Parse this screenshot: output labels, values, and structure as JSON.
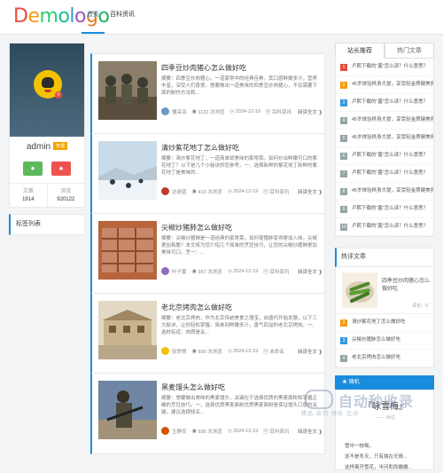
{
  "header": {
    "logo": [
      "D",
      "e",
      "m",
      "o",
      "l",
      "o",
      "g",
      "o"
    ],
    "logo_colors": [
      "#e84c3d",
      "#f39c12",
      "#2ecc71",
      "#1abc9c",
      "#3498db",
      "#9b59b6",
      "#e67e22",
      "#27ae60"
    ],
    "nav": [
      "首页",
      "百科资讯"
    ]
  },
  "profile": {
    "name": "admin",
    "badge": "管理",
    "wechat_icon": "wechat-icon",
    "qq_icon": "qq-icon",
    "stats": [
      {
        "label": "文章",
        "value": "1914"
      },
      {
        "label": "浏览",
        "value": "920122"
      }
    ]
  },
  "tags": {
    "title": "标签列表"
  },
  "posts": [
    {
      "title": "四季豆炒肉猪心怎么做好吃",
      "desc": "摘要：四季豆炒肉猪心，一道家常中的经典佳肴，其口感鲜嫩多汁，营养丰富，深受人们喜爱。想要做出一道美味的四季豆炒肉猪心，不仅需要下面的制作方法和...",
      "author": "懂采羽",
      "views": "1132 次浏览",
      "date": "2024-12-19",
      "cat": "百科资讯",
      "more": "阅读全文"
    },
    {
      "title": "清炒紫花地丁怎么做好吃",
      "desc": "摘要：清炒紫花地丁，一道简单却美味的家常菜。如何炒出鲜嫩可口的紫花地丁？以下是几个小秘诀供您参考。一、选择新鲜的紫花地丁新鲜的紫花地丁是美味的...",
      "author": "访谢蓝",
      "views": "413 次浏览",
      "date": "2024-12-19",
      "cat": "百科资讯",
      "more": "阅读全文"
    },
    {
      "title": "尖椒炒猪肺怎么做好吃",
      "desc": "摘要：尖椒炒猪肺是一道经典的家常菜，如何使猪肺变得更加入味，尖椒更加爽脆？本文将为您介绍几个简单的烹饪技巧，让您的尖椒炒猪肺更加美味可口。烹一：...",
      "author": "叶子夏",
      "views": "357 次浏览",
      "date": "2024-12-19",
      "cat": "百科资讯",
      "more": "阅读全文"
    },
    {
      "title": "老北京烤肉怎么做好吃",
      "desc": "摘要：老北京烤肉，作为北京传统美食之瑰宝，自唐代开始发展，以下三大秘诀，让你轻松掌握。简单到鲜嫩多汁，香气四溢的老北京烤肉。一、选材有道：肉质是关...",
      "author": "张梦想",
      "views": "590 次浏览",
      "date": "2024-12-19",
      "cat": "未命名",
      "more": "阅读全文"
    },
    {
      "title": "黑麦馒头怎么做好吃",
      "desc": "摘要：想要做出美味的黑麦馒头，关键在于选择优质的黑麦面粉和掌握正确的烹饪技巧。一、选择优质黑麦面粉优质黑麦面粉是保证馒头口感的关键，建议选择知名...",
      "author": "玉静安",
      "views": "595 次浏览",
      "date": "2024-12-19",
      "cat": "百科资讯",
      "more": "阅读全文"
    }
  ],
  "sidebar": {
    "tabs": [
      "站长推荐",
      "热门文章"
    ],
    "list": [
      {
        "n": "1",
        "t": "卢熙下载的“菌”怎么读？什么意思？"
      },
      {
        "n": "2",
        "t": "45岁体验终身大提，享受轻金质健美俱乐..."
      },
      {
        "n": "3",
        "t": "卢熙下载的“菌”怎么读？什么意思？"
      },
      {
        "n": "4",
        "t": "45岁体验终身大提，享受轻金质健美俱乐..."
      },
      {
        "n": "5",
        "t": "45岁体验终身大提，享受轻金质健美俱乐..."
      },
      {
        "n": "6",
        "t": "卢熙下载的“菌”怎么读？什么意思？"
      },
      {
        "n": "7",
        "t": "卢熙下载的“菌”怎么读？什么意思？"
      },
      {
        "n": "8",
        "t": "45岁体验终身大提，享受轻金质健美俱乐..."
      },
      {
        "n": "9",
        "t": "卢熙下载的“菌”怎么读？什么意思？"
      },
      {
        "n": "10",
        "t": "卢熙下载的“菌”怎么读？什么意思？"
      }
    ],
    "num_colors": [
      "#e74c3c",
      "#f39c12",
      "#3498db",
      "#95a5a6",
      "#95a5a6",
      "#95a5a6",
      "#95a5a6",
      "#95a5a6",
      "#95a5a6",
      "#95a5a6"
    ],
    "hot_title": "热评文章",
    "hot_first": {
      "title": "四季豆炒肉猪心怎么做好吃",
      "sub": "评论：0"
    },
    "hot_list": [
      {
        "n": "2",
        "t": "清炒紫花地丁怎么做好吃"
      },
      {
        "n": "3",
        "t": "尖椒炒猪肺怎么做好吃"
      },
      {
        "n": "4",
        "t": "老北京烤肉怎么做好吃"
      }
    ],
    "hot_colors": [
      "#f39c12",
      "#3498db",
      "#95a5a6"
    ],
    "random_title": "随机",
    "quote_title": "『咏雪梅』",
    "quote_sub": "—— 诗词",
    "quote_lines": [
      "雪中一枝梅，",
      "这不是冬天，只有独在无情...",
      "这样离开雪花，半问和尚缴缴..."
    ]
  },
  "watermark": {
    "big": "自动秒收录",
    "small": "精品·技巧·领先·互动"
  }
}
